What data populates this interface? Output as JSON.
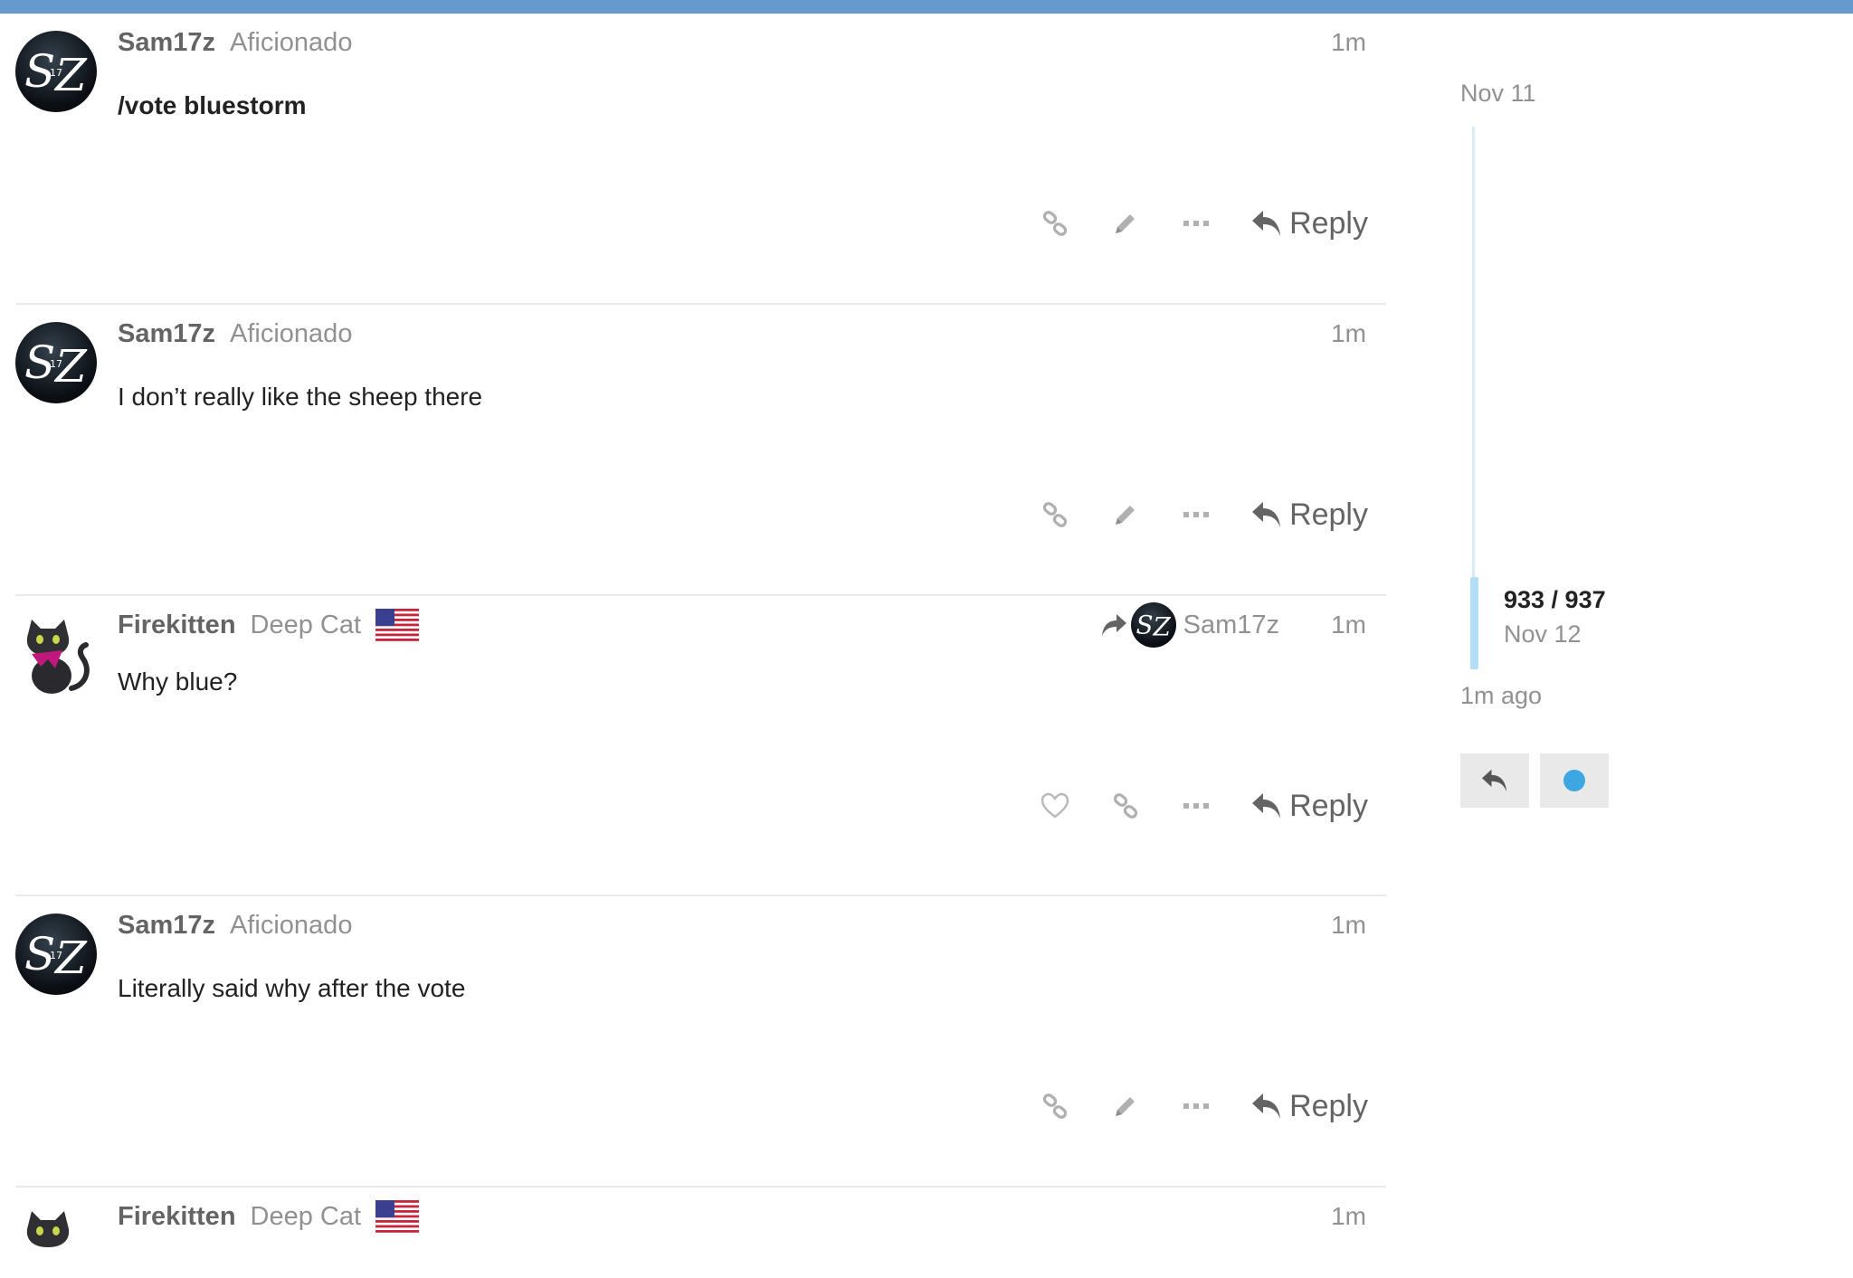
{
  "posts": [
    {
      "username": "Sam17z",
      "user_title": "Aficionado",
      "time": "1m",
      "body": "/vote bluestorm",
      "reply_label": "Reply"
    },
    {
      "username": "Sam17z",
      "user_title": "Aficionado",
      "time": "1m",
      "body": "I don’t really like the sheep there",
      "reply_label": "Reply"
    },
    {
      "username": "Firekitten",
      "user_title": "Deep Cat",
      "reply_to_user": "Sam17z",
      "time": "1m",
      "body": "Why blue?",
      "reply_label": "Reply"
    },
    {
      "username": "Sam17z",
      "user_title": "Aficionado",
      "time": "1m",
      "body": "Literally said why after the vote",
      "reply_label": "Reply"
    },
    {
      "username": "Firekitten",
      "user_title": "Deep Cat",
      "time": "1m"
    }
  ],
  "timeline": {
    "start_date": "Nov 11",
    "position": "933 / 937",
    "current_date": "Nov 12",
    "last_activity": "1m ago"
  },
  "colors": {
    "header_bar": "#6699cc",
    "timeline_track": "#d6ecf8",
    "timeline_handle": "#b3def8",
    "unread_dot": "#3ea6e1",
    "muted_text": "#919191"
  },
  "icons": {
    "link": "link-icon",
    "edit": "pencil-icon",
    "more": "more-icon",
    "reply": "reply-icon",
    "like": "heart-icon",
    "reply_to": "share-arrow-icon"
  }
}
